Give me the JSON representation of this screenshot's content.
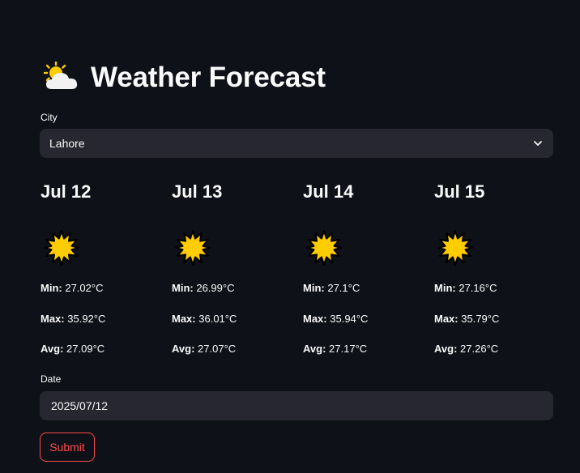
{
  "app": {
    "title_icon": "sun-behind-cloud-icon",
    "title": "Weather Forecast"
  },
  "city": {
    "label": "City",
    "value": "Lahore",
    "icon": "chevron-down-icon"
  },
  "forecast": [
    {
      "date": "Jul 12",
      "icon": "sun-icon",
      "min_label": "Min:",
      "min": "27.02°C",
      "max_label": "Max:",
      "max": "35.92°C",
      "avg_label": "Avg:",
      "avg": "27.09°C"
    },
    {
      "date": "Jul 13",
      "icon": "sun-icon",
      "min_label": "Min:",
      "min": "26.99°C",
      "max_label": "Max:",
      "max": "36.01°C",
      "avg_label": "Avg:",
      "avg": "27.07°C"
    },
    {
      "date": "Jul 14",
      "icon": "sun-icon",
      "min_label": "Min:",
      "min": "27.1°C",
      "max_label": "Max:",
      "max": "35.94°C",
      "avg_label": "Avg:",
      "avg": "27.17°C"
    },
    {
      "date": "Jul 15",
      "icon": "sun-icon",
      "min_label": "Min:",
      "min": "27.16°C",
      "max_label": "Max:",
      "max": "35.79°C",
      "avg_label": "Avg:",
      "avg": "27.26°C"
    }
  ],
  "date": {
    "label": "Date",
    "value": "2025/07/12"
  },
  "submit": {
    "label": "Submit"
  },
  "colors": {
    "background": "#0e1117",
    "input_bg": "#262730",
    "text": "#fafafa",
    "accent": "#ff4b4b",
    "sun": "#ffcc00"
  }
}
